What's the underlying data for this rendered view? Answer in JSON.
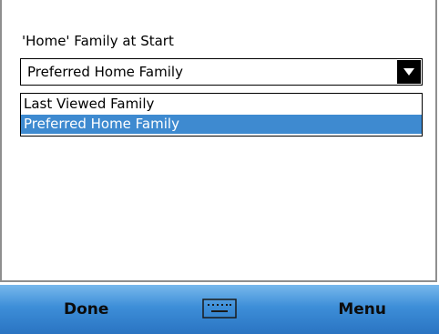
{
  "setting": {
    "label": "'Home' Family at Start",
    "selected_value": "Preferred Home Family",
    "options": [
      "Last Viewed Family",
      "Preferred Home Family"
    ]
  },
  "menubar": {
    "left_softkey": "Done",
    "right_softkey": "Menu",
    "center_icon": "keyboard-icon"
  },
  "colors": {
    "selection": "#3e8ad0",
    "menubar_top": "#77b8ec",
    "menubar_bottom": "#2a74c2"
  }
}
